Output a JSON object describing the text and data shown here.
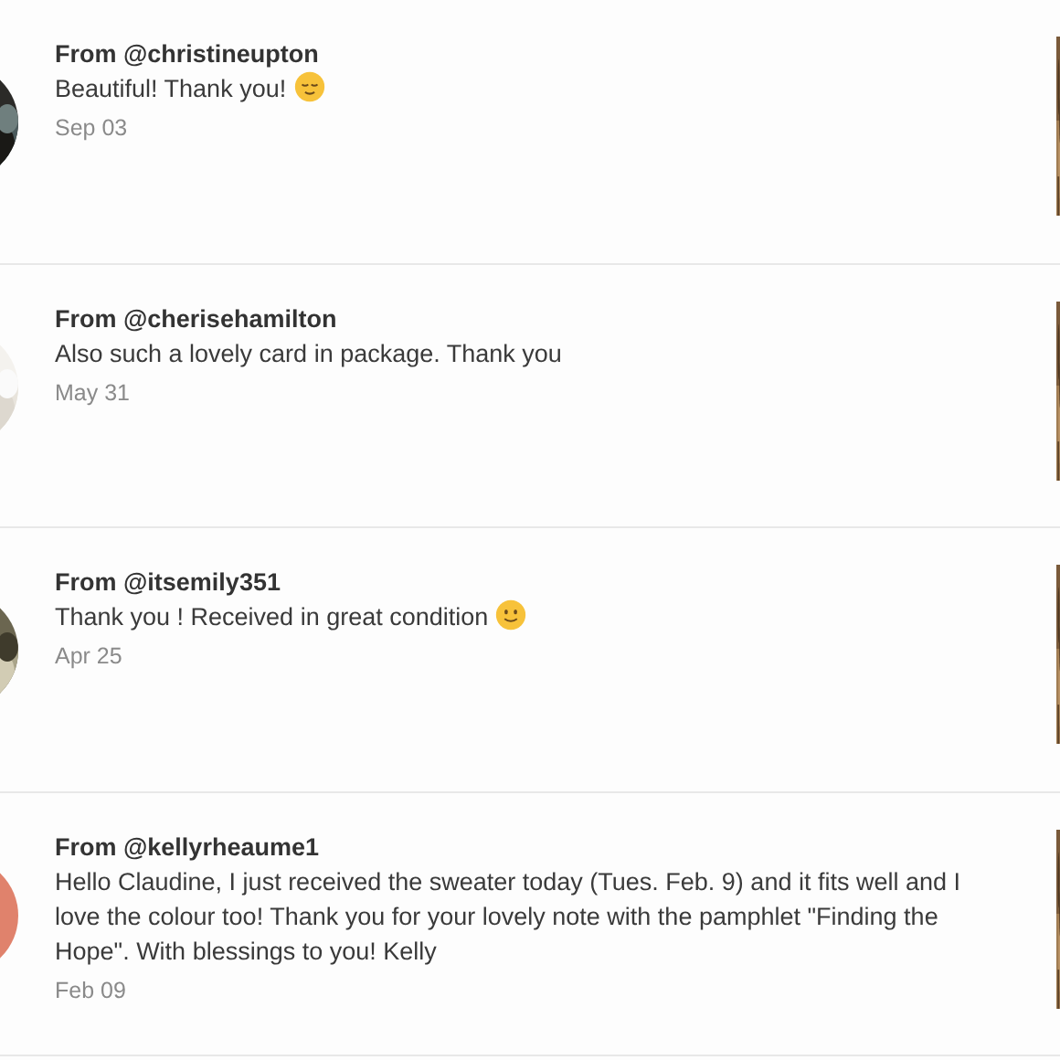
{
  "messages": [
    {
      "from": "From @christineupton",
      "text": "Beautiful! Thank you!",
      "emoji": {
        "kind": "relieved"
      },
      "date": "Sep 03"
    },
    {
      "from": "From @cherisehamilton",
      "text": "Also such a lovely card in package. Thank you",
      "date": "May 31"
    },
    {
      "from": "From @itsemily351",
      "text": "Thank you ! Received in great condition",
      "emoji": {
        "kind": "smile"
      },
      "date": "Apr 25"
    },
    {
      "from": "From @kellyrheaume1",
      "text": "Hello Claudine, I just received the sweater today (Tues. Feb. 9) and it fits well and I love the colour too! Thank you for your lovely note with the pamphlet \"Finding the Hope\". With blessings to you! Kelly",
      "date": "Feb 09",
      "avatar": {
        "kind": "color",
        "color": "#e0826c"
      }
    }
  ]
}
